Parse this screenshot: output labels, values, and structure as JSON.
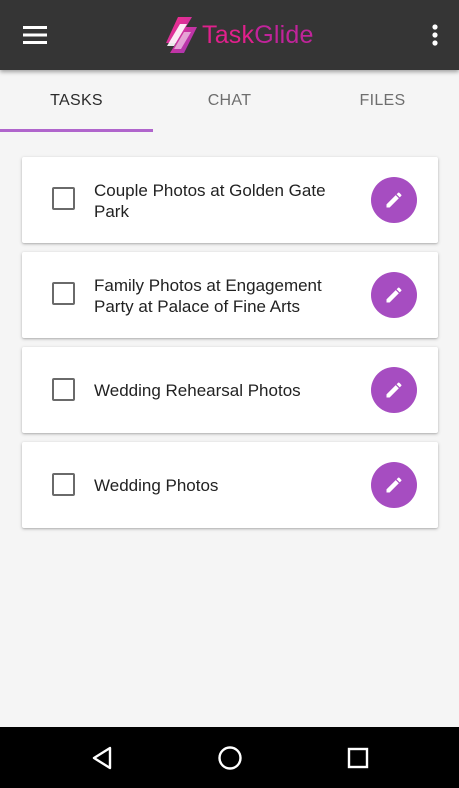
{
  "app": {
    "brand_part1": "Task",
    "brand_part2": "Glide",
    "colors": {
      "appbar": "#353535",
      "accent": "#a64dc1",
      "brand_pink": "#e0208c",
      "brand_purple": "#9b3ab8"
    }
  },
  "appbar": {
    "menu_icon": "hamburger-menu-icon",
    "more_icon": "more-vertical-icon"
  },
  "tabs": [
    {
      "label": "TASKS",
      "active": true
    },
    {
      "label": "CHAT",
      "active": false
    },
    {
      "label": "FILES",
      "active": false
    }
  ],
  "tasks": [
    {
      "title": "Couple Photos at Golden Gate Park",
      "checked": false,
      "action_icon": "pencil-icon"
    },
    {
      "title": "Family Photos at Engagement Party at Palace of Fine Arts",
      "checked": false,
      "action_icon": "pencil-icon"
    },
    {
      "title": "Wedding Rehearsal Photos",
      "checked": false,
      "action_icon": "pencil-icon"
    },
    {
      "title": "Wedding Photos",
      "checked": false,
      "action_icon": "pencil-icon"
    }
  ],
  "navbar": {
    "back_icon": "back-triangle-icon",
    "home_icon": "home-circle-icon",
    "recents_icon": "recents-square-icon"
  }
}
